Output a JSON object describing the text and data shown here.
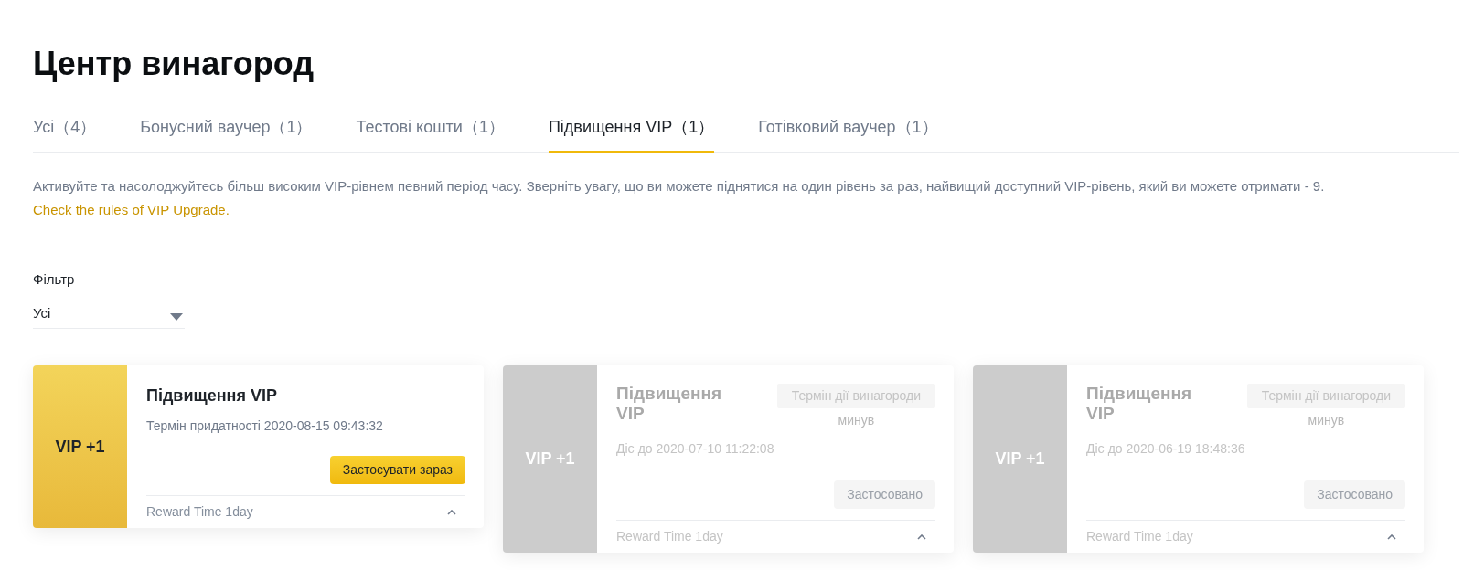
{
  "title": "Центр винагород",
  "tabs": [
    {
      "label": "Усі（4）",
      "selected": false
    },
    {
      "label": "Бонусний ваучер（1）",
      "selected": false
    },
    {
      "label": "Тестові кошти（1）",
      "selected": false
    },
    {
      "label": "Підвищення VIP（1）",
      "selected": true
    },
    {
      "label": "Готівковий ваучер（1）",
      "selected": false
    }
  ],
  "description": {
    "text": "Активуйте та насолоджуйтесь більш високим VIP-рівнем певний період часу. Зверніть увагу, що ви можете піднятися на один рівень за раз, найвищий доступний VIP-рівень, який ви можете отримати - 9.",
    "link": "Check the rules of VIP Upgrade."
  },
  "filter": {
    "label": "Фільтр",
    "value": "Усі"
  },
  "cards": [
    {
      "kind": "active",
      "badge": "VIP +1",
      "title": "Підвищення VIP",
      "date": "Термін придатності 2020-08-15 09:43:32",
      "button": "Застосувати зараз",
      "footer": "Reward Time 1day"
    },
    {
      "kind": "expired",
      "badge": "VIP +1",
      "title": "Підвищення VIP",
      "status": "Термін дії винагороди",
      "status_2": "минув",
      "date": "Діє до 2020-07-10 11:22:08",
      "button": "Застосовано",
      "footer": "Reward Time 1day"
    },
    {
      "kind": "expired",
      "badge": "VIP +1",
      "title": "Підвищення VIP",
      "status": "Термін дії винагороди",
      "status_2": "минув",
      "date": "Діє до 2020-06-19 18:48:36",
      "button": "Застосовано",
      "footer": "Reward Time 1day"
    }
  ]
}
